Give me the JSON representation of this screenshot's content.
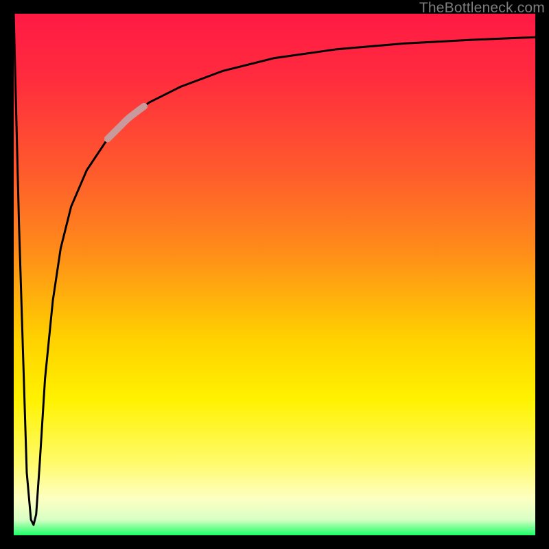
{
  "watermark": "TheBottleneck.com",
  "colors": {
    "frame": "#000000",
    "curve": "#000000",
    "highlight": "#c99a9b",
    "gradient_stops": [
      {
        "pos": 0.0,
        "color": "#ff1a45"
      },
      {
        "pos": 0.12,
        "color": "#ff2b3e"
      },
      {
        "pos": 0.3,
        "color": "#ff5a2d"
      },
      {
        "pos": 0.45,
        "color": "#ff8a1a"
      },
      {
        "pos": 0.62,
        "color": "#ffd000"
      },
      {
        "pos": 0.74,
        "color": "#fff200"
      },
      {
        "pos": 0.86,
        "color": "#fffb6a"
      },
      {
        "pos": 0.93,
        "color": "#fdffc2"
      },
      {
        "pos": 0.97,
        "color": "#d8ffc5"
      },
      {
        "pos": 1.0,
        "color": "#1aff66"
      }
    ]
  },
  "chart_data": {
    "type": "line",
    "title": "",
    "xlabel": "",
    "ylabel": "",
    "xlim": [
      0,
      100
    ],
    "ylim": [
      0,
      100
    ],
    "note": "Axes unlabeled; values are percentages of plot area (0=left/bottom, 100=right/top). Curve starts at top-left, drops sharply to a narrow minimum near the bottom, then rises and asymptotically flattens toward the top-right. A short faded/highlighted segment sits on the rising portion around x≈18–25.",
    "series": [
      {
        "name": "curve",
        "x": [
          0,
          1.0,
          2.5,
          3.3,
          3.8,
          4.3,
          5.0,
          6.0,
          7.5,
          9.0,
          11,
          14,
          18,
          22,
          26,
          32,
          40,
          50,
          62,
          75,
          88,
          100
        ],
        "y": [
          100,
          60,
          12,
          3,
          2,
          4,
          14,
          30,
          45,
          55,
          63,
          70,
          76,
          80,
          83,
          86,
          89,
          91.5,
          93.2,
          94.3,
          95.0,
          95.5
        ]
      }
    ],
    "highlight_segment": {
      "x_start": 18,
      "x_end": 25
    }
  }
}
